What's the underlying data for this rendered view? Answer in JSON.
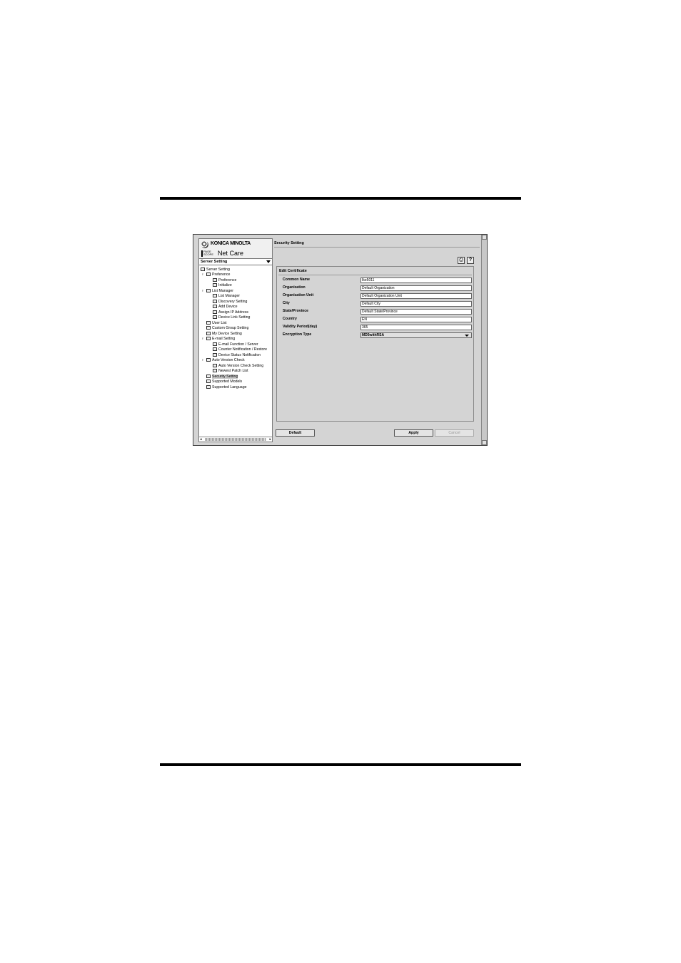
{
  "brand": {
    "company": "KONICA MINOLTA",
    "product_prefix": "PAGE SCOPE",
    "product": "Net Care"
  },
  "sidebar": {
    "selector": "Server Setting",
    "tree": [
      {
        "label": "Server Setting"
      },
      {
        "label": "Preference"
      },
      {
        "label": "Preference"
      },
      {
        "label": "Initialize"
      },
      {
        "label": "List Manager"
      },
      {
        "label": "List Manager"
      },
      {
        "label": "Discovery Setting"
      },
      {
        "label": "Add Device"
      },
      {
        "label": "Assign IP Address"
      },
      {
        "label": "Device Link Setting"
      },
      {
        "label": "User List"
      },
      {
        "label": "Custom Group Setting"
      },
      {
        "label": "My Device Setting"
      },
      {
        "label": "E-mail Setting"
      },
      {
        "label": "E-mail Function / Server"
      },
      {
        "label": "Counter Notification / Restore"
      },
      {
        "label": "Device Status Notification"
      },
      {
        "label": "Auto Version Check"
      },
      {
        "label": "Auto Version Check Setting"
      },
      {
        "label": "Newest Patch List"
      },
      {
        "label": "Security Setting"
      },
      {
        "label": "Supported Models"
      },
      {
        "label": "Supported Language"
      }
    ]
  },
  "main": {
    "title": "Security Setting",
    "print_icon": "print-icon",
    "help_label": "?",
    "group_title": "Edit Certificate",
    "fields": [
      {
        "label": "Common Name",
        "value": "Ike5011"
      },
      {
        "label": "Organization",
        "value": "Default Organization"
      },
      {
        "label": "Organization Unit",
        "value": "Default Organization Unit"
      },
      {
        "label": "City",
        "value": "Default City"
      },
      {
        "label": "State/Province",
        "value": "Default State/Province"
      },
      {
        "label": "Country",
        "value": "EN"
      },
      {
        "label": "Validity Period(day)",
        "value": "365"
      },
      {
        "label": "Encryption Type",
        "value": "MD5withRSA"
      }
    ],
    "buttons": {
      "default": "Default",
      "apply": "Apply",
      "cancel": "Cancel"
    }
  }
}
